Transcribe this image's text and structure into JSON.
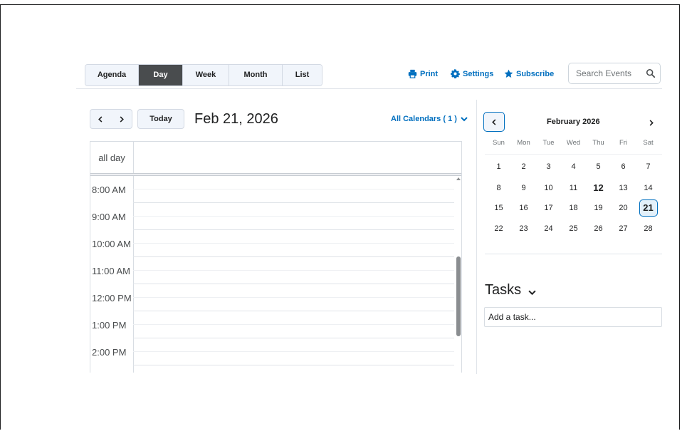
{
  "toolbar": {
    "view_tabs": [
      {
        "label": "Agenda",
        "active": false
      },
      {
        "label": "Day",
        "active": true
      },
      {
        "label": "Week",
        "active": false
      },
      {
        "label": "Month",
        "active": false
      },
      {
        "label": "List",
        "active": false
      }
    ],
    "print_label": "Print",
    "settings_label": "Settings",
    "subscribe_label": "Subscribe",
    "search_placeholder": "Search Events"
  },
  "day_view": {
    "today_label": "Today",
    "date_title": "Feb 21, 2026",
    "calendars_label": "All Calendars ( 1 )",
    "all_day_label": "all day",
    "hours": [
      "8:00 AM",
      "9:00 AM",
      "10:00 AM",
      "11:00 AM",
      "12:00 PM",
      "1:00 PM",
      "2:00 PM"
    ]
  },
  "mini_calendar": {
    "title": "February 2026",
    "weekdays": [
      "Sun",
      "Mon",
      "Tue",
      "Wed",
      "Thu",
      "Fri",
      "Sat"
    ],
    "weeks": [
      [
        "1",
        "2",
        "3",
        "4",
        "5",
        "6",
        "7"
      ],
      [
        "8",
        "9",
        "10",
        "11",
        "12",
        "13",
        "14"
      ],
      [
        "15",
        "16",
        "17",
        "18",
        "19",
        "20",
        "21"
      ],
      [
        "22",
        "23",
        "24",
        "25",
        "26",
        "27",
        "28"
      ]
    ],
    "today_day": "12",
    "selected_day": "21"
  },
  "tasks": {
    "title": "Tasks",
    "add_placeholder": "Add a task..."
  },
  "colors": {
    "accent": "#006fbf",
    "active_tab": "#494c4e",
    "tab_bg": "#f1f5fb"
  },
  "icons": {
    "print": "printer-icon",
    "settings": "gear-icon",
    "subscribe": "star-icon",
    "search": "search-icon"
  }
}
